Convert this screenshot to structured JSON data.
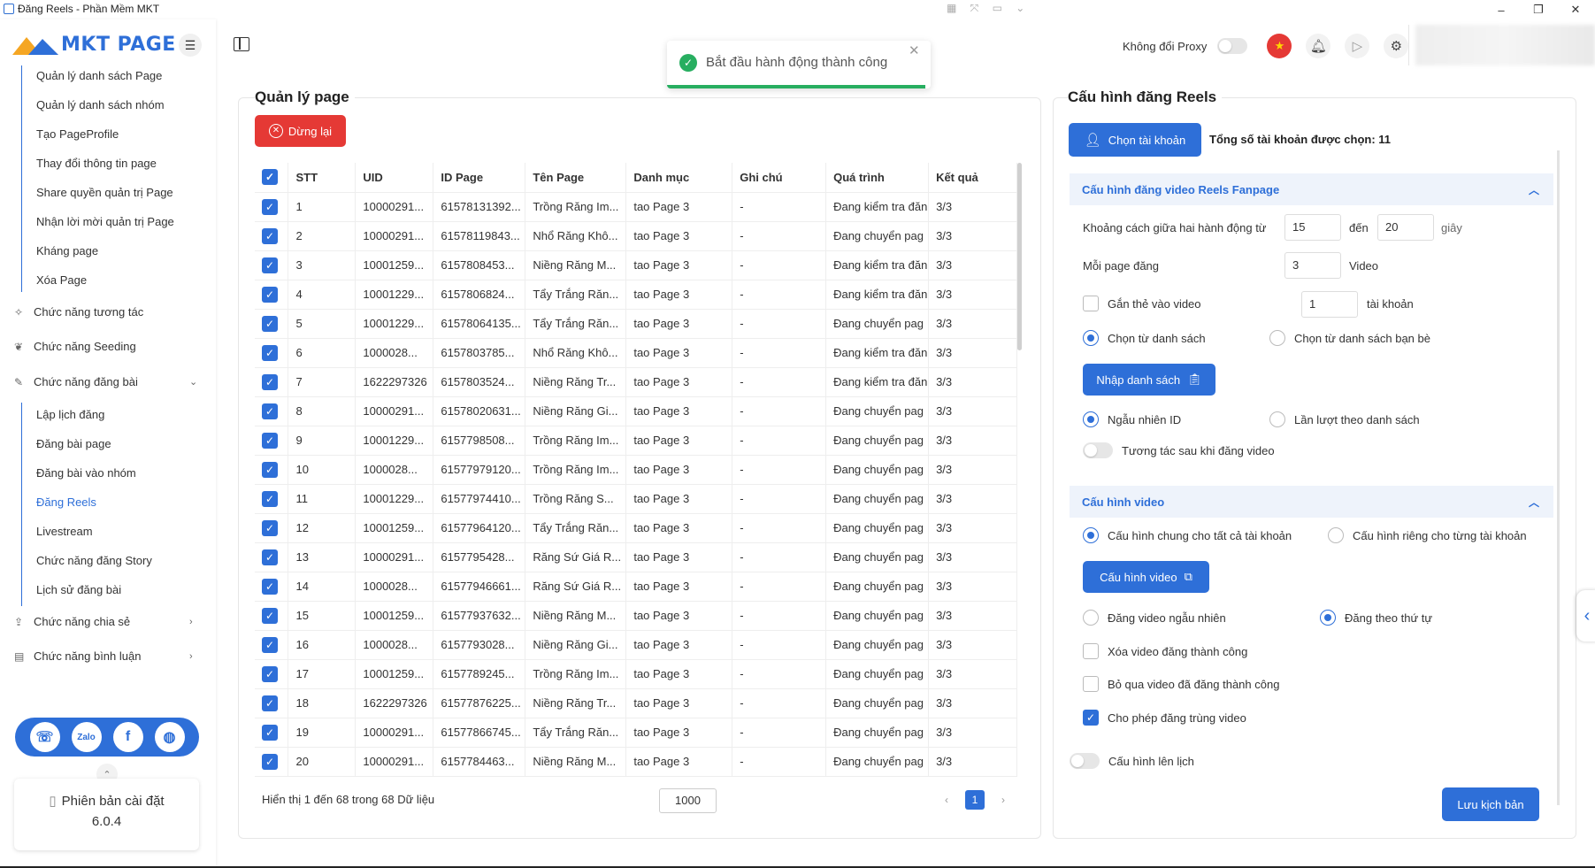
{
  "window": {
    "title": "Đăng Reels - Phần Mềm MKT",
    "minimize": "–",
    "maximize": "❐",
    "close": "✕"
  },
  "brand": {
    "name": "MKT PAGE"
  },
  "sidebar": {
    "page_items": [
      {
        "label": "Quản lý danh sách Page"
      },
      {
        "label": "Quản lý danh sách nhóm"
      },
      {
        "label": "Tạo PageProfile"
      },
      {
        "label": "Thay đổi thông tin page"
      },
      {
        "label": "Share quyền quản trị Page"
      },
      {
        "label": "Nhận lời mời quản trị Page"
      },
      {
        "label": "Kháng page"
      },
      {
        "label": "Xóa Page"
      }
    ],
    "groups": {
      "interact": "Chức năng tương tác",
      "seeding": "Chức năng Seeding",
      "post": "Chức năng đăng bài",
      "share": "Chức năng chia sẻ",
      "comment": "Chức năng bình luận"
    },
    "post_items": [
      {
        "label": "Lập lịch đăng"
      },
      {
        "label": "Đăng bài page"
      },
      {
        "label": "Đăng bài vào nhóm"
      },
      {
        "label": "Đăng Reels"
      },
      {
        "label": "Livestream"
      },
      {
        "label": "Chức năng đăng Story"
      },
      {
        "label": "Lịch sử đăng bài"
      }
    ],
    "version_label": "Phiên bản cài đặt",
    "version_number": "6.0.4"
  },
  "header": {
    "proxy_label": "Không đổi Proxy"
  },
  "toast": {
    "message": "Bắt đầu hành động thành công",
    "progress": 0.98
  },
  "left_panel": {
    "title": "Quản lý page",
    "stop_button": "Dừng lại",
    "columns": [
      "STT",
      "UID",
      "ID Page",
      "Tên Page",
      "Danh mục",
      "Ghi chú",
      "Quá trình",
      "Kết quả"
    ],
    "rows": [
      [
        "1",
        "10000291...",
        "61578131392...",
        "Trồng Răng Im...",
        "tao Page 3",
        "-",
        "Đang kiểm tra đăn",
        "3/3"
      ],
      [
        "2",
        "10000291...",
        "61578119843...",
        "Nhổ Răng Khô...",
        "tao Page 3",
        "-",
        "Đang chuyển pag",
        "3/3"
      ],
      [
        "3",
        "10001259...",
        "6157808453...",
        "Niềng Răng M...",
        "tao Page 3",
        "-",
        "Đang kiểm tra đăn",
        "3/3"
      ],
      [
        "4",
        "10001229...",
        "6157806824...",
        "Tẩy Trắng Răn...",
        "tao Page 3",
        "-",
        "Đang kiểm tra đăn",
        "3/3"
      ],
      [
        "5",
        "10001229...",
        "61578064135...",
        "Tẩy Trắng Răn...",
        "tao Page 3",
        "-",
        "Đang chuyển pag",
        "3/3"
      ],
      [
        "6",
        "1000028...",
        "6157803785...",
        "Nhổ Răng Khô...",
        "tao Page 3",
        "-",
        "Đang kiểm tra đăn",
        "3/3"
      ],
      [
        "7",
        "1622297326",
        "6157803524...",
        "Niềng Răng Tr...",
        "tao Page 3",
        "-",
        "Đang kiểm tra đăn",
        "3/3"
      ],
      [
        "8",
        "10000291...",
        "61578020631...",
        "Niềng Răng Gi...",
        "tao Page 3",
        "-",
        "Đang chuyển pag",
        "3/3"
      ],
      [
        "9",
        "10001229...",
        "6157798508...",
        "Trồng Răng Im...",
        "tao Page 3",
        "-",
        "Đang chuyển pag",
        "3/3"
      ],
      [
        "10",
        "1000028...",
        "61577979120...",
        "Trồng Răng Im...",
        "tao Page 3",
        "-",
        "Đang chuyển pag",
        "3/3"
      ],
      [
        "11",
        "10001229...",
        "61577974410...",
        "Trồng Răng S...",
        "tao Page 3",
        "-",
        "Đang chuyển pag",
        "3/3"
      ],
      [
        "12",
        "10001259...",
        "61577964120...",
        "Tẩy Trắng Răn...",
        "tao Page 3",
        "-",
        "Đang chuyển pag",
        "3/3"
      ],
      [
        "13",
        "10000291...",
        "6157795428...",
        "Răng Sứ Giá R...",
        "tao Page 3",
        "-",
        "Đang chuyển pag",
        "3/3"
      ],
      [
        "14",
        "1000028...",
        "61577946661...",
        "Răng Sứ Giá R...",
        "tao Page 3",
        "-",
        "Đang chuyển pag",
        "3/3"
      ],
      [
        "15",
        "10001259...",
        "61577937632...",
        "Niềng Răng M...",
        "tao Page 3",
        "-",
        "Đang chuyển pag",
        "3/3"
      ],
      [
        "16",
        "1000028...",
        "6157793028...",
        "Niềng Răng Gi...",
        "tao Page 3",
        "-",
        "Đang chuyển pag",
        "3/3"
      ],
      [
        "17",
        "10001259...",
        "6157789245...",
        "Trồng Răng Im...",
        "tao Page 3",
        "-",
        "Đang chuyển pag",
        "3/3"
      ],
      [
        "18",
        "1622297326",
        "61577876225...",
        "Niềng Răng Tr...",
        "tao Page 3",
        "-",
        "Đang chuyển pag",
        "3/3"
      ],
      [
        "19",
        "10000291...",
        "61577866745...",
        "Tẩy Trắng Răn...",
        "tao Page 3",
        "-",
        "Đang chuyển pag",
        "3/3"
      ],
      [
        "20",
        "10000291...",
        "6157784463...",
        "Niềng Răng M...",
        "tao Page 3",
        "-",
        "Đang chuyển pag",
        "3/3"
      ]
    ],
    "footer_text": "Hiển thị 1 đến 68 trong 68 Dữ liệu",
    "page_size": "1000",
    "current_page": "1",
    "prev": "‹",
    "next": "›"
  },
  "right_panel": {
    "title": "Cấu hình đăng Reels",
    "choose_account": "Chọn tài khoản",
    "total_selected": "Tổng số tài khoản được chọn: 11",
    "section1_title": "Cấu hình đăng video Reels Fanpage",
    "interval_label": "Khoảng cách giữa hai hành động từ",
    "interval_from": "15",
    "to_label": "đến",
    "interval_to": "20",
    "seconds": "giây",
    "per_page_label": "Mỗi page đăng",
    "per_page_value": "3",
    "video_unit": "Video",
    "tag_label": "Gắn thẻ vào video",
    "tag_value": "1",
    "account_unit": "tài khoản",
    "radio_from_list": "Chọn từ danh sách",
    "radio_from_friends": "Chọn từ danh sách bạn bè",
    "import_list": "Nhập danh sách",
    "radio_random_id": "Ngẫu nhiên ID",
    "radio_sequential": "Lần lượt theo danh sách",
    "interact_after": "Tương tác sau khi đăng video",
    "section2_title": "Cấu hình video",
    "radio_common": "Cấu hình chung cho tất cả tài khoản",
    "radio_each": "Cấu hình riêng cho từng tài khoản",
    "video_config_btn": "Cấu hình video",
    "radio_random_video": "Đăng video ngẫu nhiên",
    "radio_order": "Đăng theo thứ tự",
    "cb_delete": "Xóa video đăng thành công",
    "cb_skip": "Bỏ qua video đã đăng thành công",
    "cb_duplicate": "Cho phép đăng trùng video",
    "schedule_label": "Cấu hình lên lịch",
    "save_button": "Lưu kịch bản"
  }
}
